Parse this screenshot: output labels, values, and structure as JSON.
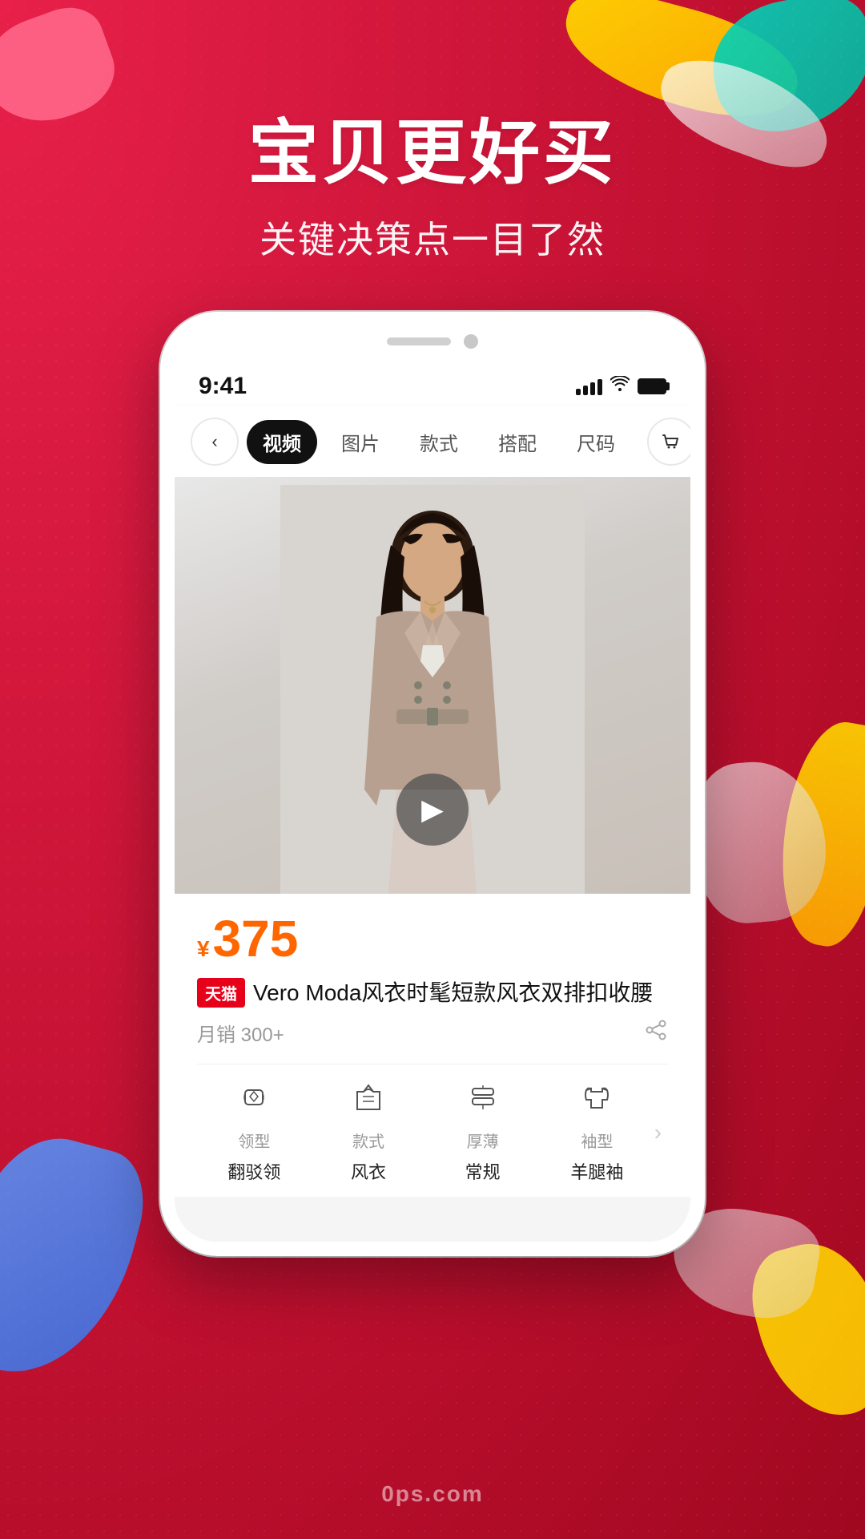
{
  "background": {
    "primary_color": "#c8102e",
    "secondary_color": "#f03060"
  },
  "headline": {
    "main": "宝贝更好买",
    "sub": "关键决策点一目了然"
  },
  "phone": {
    "status_bar": {
      "time": "9:41",
      "signal": "●●●",
      "wifi": "WiFi",
      "battery": "■"
    },
    "nav_tabs": {
      "back_label": "‹",
      "tabs": [
        {
          "label": "视频",
          "active": true
        },
        {
          "label": "图片",
          "active": false
        },
        {
          "label": "款式",
          "active": false
        },
        {
          "label": "搭配",
          "active": false
        },
        {
          "label": "尺码",
          "active": false
        }
      ],
      "cart_icon": "🛒",
      "more_icon": "···"
    },
    "product": {
      "price_symbol": "¥",
      "price": "375",
      "platform_badge": "天猫",
      "title": "Vero Moda风衣时髦短款风衣双排扣收腰",
      "monthly_sales": "月销 300+",
      "play_button": "▶",
      "features": [
        {
          "icon": "👜",
          "label": "领型",
          "value": "翻驳领"
        },
        {
          "icon": "👕",
          "label": "款式",
          "value": "风衣"
        },
        {
          "icon": "📦",
          "label": "厚薄",
          "value": "常规"
        },
        {
          "icon": "🧥",
          "label": "袖型",
          "value": "羊腿袖"
        }
      ],
      "feature_arrow": "›"
    }
  },
  "watermark": {
    "text": "0ps.com"
  }
}
